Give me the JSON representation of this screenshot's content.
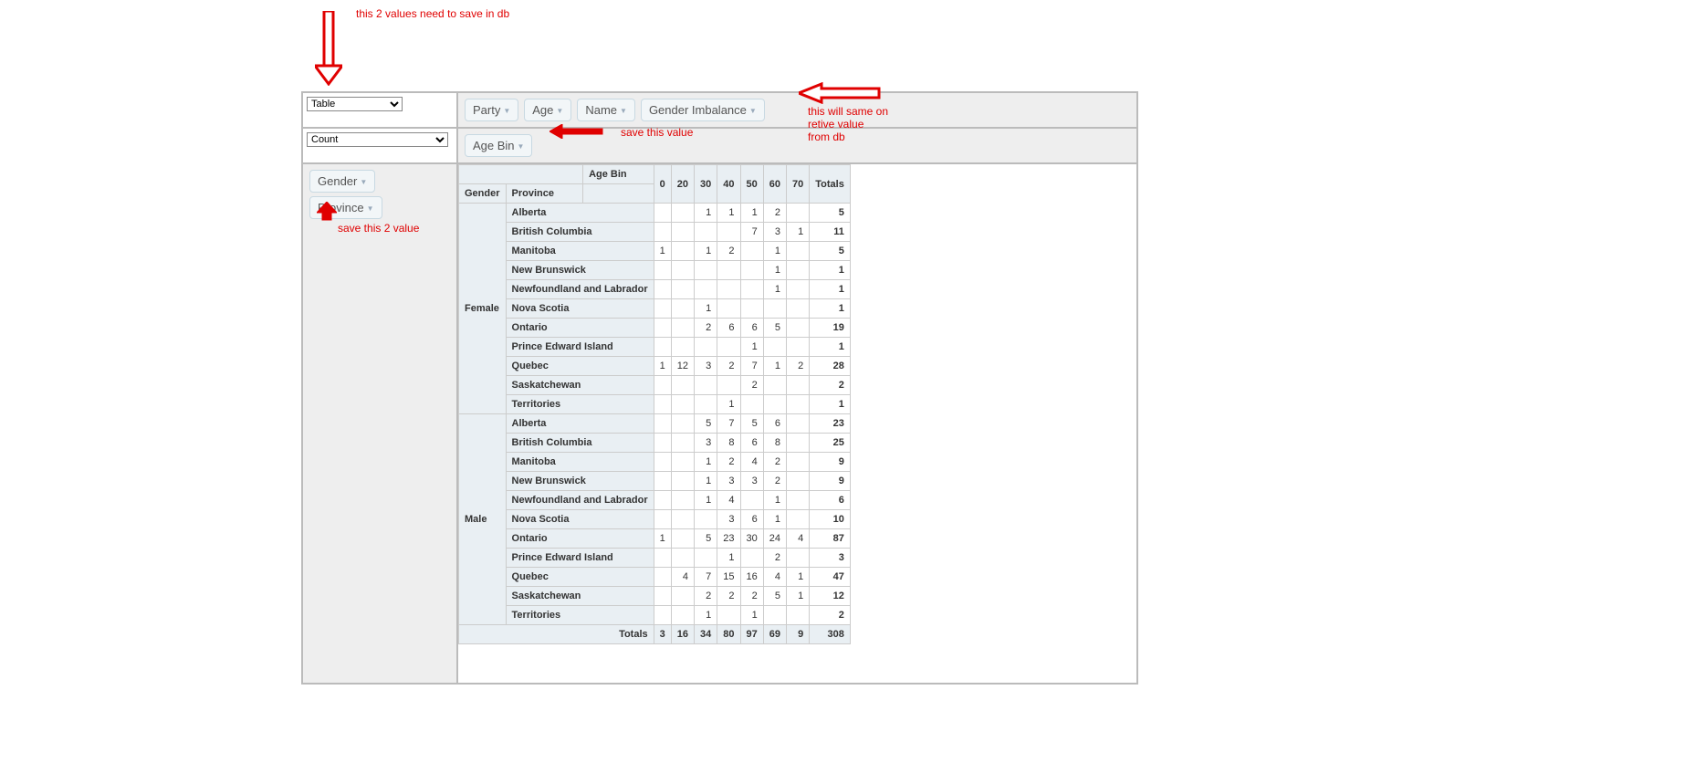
{
  "annotations": {
    "top": "this 2 values need to save in db",
    "rows": "save this 2 value",
    "cols": "save this value",
    "right1": "this will same on",
    "right2": "retive value",
    "right3": "from db"
  },
  "renderers": {
    "selected": "Table"
  },
  "aggregators": {
    "selected": "Count"
  },
  "unused_attrs": [
    "Party",
    "Age",
    "Name",
    "Gender Imbalance"
  ],
  "col_attrs": [
    "Age Bin"
  ],
  "row_attrs": [
    "Gender",
    "Province"
  ],
  "col_header": "Age Bin",
  "col_buckets": [
    "0",
    "20",
    "30",
    "40",
    "50",
    "60",
    "70"
  ],
  "totals_label": "Totals",
  "row_header_labels": [
    "Gender",
    "Province"
  ],
  "data_rows": [
    {
      "gender": "Female",
      "province": "Alberta",
      "cells": [
        "",
        "",
        "1",
        "1",
        "1",
        "2",
        ""
      ],
      "total": "5",
      "show_gender": false
    },
    {
      "gender": "Female",
      "province": "British Columbia",
      "cells": [
        "",
        "",
        "",
        "",
        "7",
        "3",
        "1"
      ],
      "total": "11",
      "show_gender": false
    },
    {
      "gender": "Female",
      "province": "Manitoba",
      "cells": [
        "1",
        "",
        "1",
        "2",
        "",
        "1",
        ""
      ],
      "total": "5",
      "show_gender": false
    },
    {
      "gender": "Female",
      "province": "New Brunswick",
      "cells": [
        "",
        "",
        "",
        "",
        "",
        "1",
        ""
      ],
      "total": "1",
      "show_gender": false
    },
    {
      "gender": "Female",
      "province": "Newfoundland and Labrador",
      "cells": [
        "",
        "",
        "",
        "",
        "",
        "1",
        ""
      ],
      "total": "1",
      "show_gender": false
    },
    {
      "gender": "Female",
      "province": "Nova Scotia",
      "cells": [
        "",
        "",
        "1",
        "",
        "",
        "",
        ""
      ],
      "total": "1",
      "show_gender": true
    },
    {
      "gender": "Female",
      "province": "Ontario",
      "cells": [
        "",
        "",
        "2",
        "6",
        "6",
        "5",
        ""
      ],
      "total": "19",
      "show_gender": false
    },
    {
      "gender": "Female",
      "province": "Prince Edward Island",
      "cells": [
        "",
        "",
        "",
        "",
        "1",
        "",
        ""
      ],
      "total": "1",
      "show_gender": false
    },
    {
      "gender": "Female",
      "province": "Quebec",
      "cells": [
        "1",
        "12",
        "3",
        "2",
        "7",
        "1",
        "2"
      ],
      "total": "28",
      "show_gender": false
    },
    {
      "gender": "Female",
      "province": "Saskatchewan",
      "cells": [
        "",
        "",
        "",
        "",
        "2",
        "",
        ""
      ],
      "total": "2",
      "show_gender": false
    },
    {
      "gender": "Female",
      "province": "Territories",
      "cells": [
        "",
        "",
        "",
        "1",
        "",
        "",
        ""
      ],
      "total": "1",
      "show_gender": false
    },
    {
      "gender": "Male",
      "province": "Alberta",
      "cells": [
        "",
        "",
        "5",
        "7",
        "5",
        "6",
        ""
      ],
      "total": "23",
      "show_gender": false
    },
    {
      "gender": "Male",
      "province": "British Columbia",
      "cells": [
        "",
        "",
        "3",
        "8",
        "6",
        "8",
        ""
      ],
      "total": "25",
      "show_gender": false
    },
    {
      "gender": "Male",
      "province": "Manitoba",
      "cells": [
        "",
        "",
        "1",
        "2",
        "4",
        "2",
        ""
      ],
      "total": "9",
      "show_gender": false
    },
    {
      "gender": "Male",
      "province": "New Brunswick",
      "cells": [
        "",
        "",
        "1",
        "3",
        "3",
        "2",
        ""
      ],
      "total": "9",
      "show_gender": false
    },
    {
      "gender": "Male",
      "province": "Newfoundland and Labrador",
      "cells": [
        "",
        "",
        "1",
        "4",
        "",
        "1",
        ""
      ],
      "total": "6",
      "show_gender": false
    },
    {
      "gender": "Male",
      "province": "Nova Scotia",
      "cells": [
        "",
        "",
        "",
        "3",
        "6",
        "1",
        ""
      ],
      "total": "10",
      "show_gender": true
    },
    {
      "gender": "Male",
      "province": "Ontario",
      "cells": [
        "1",
        "",
        "5",
        "23",
        "30",
        "24",
        "4"
      ],
      "total": "87",
      "show_gender": false
    },
    {
      "gender": "Male",
      "province": "Prince Edward Island",
      "cells": [
        "",
        "",
        "",
        "1",
        "",
        "2",
        ""
      ],
      "total": "3",
      "show_gender": false
    },
    {
      "gender": "Male",
      "province": "Quebec",
      "cells": [
        "",
        "4",
        "7",
        "15",
        "16",
        "4",
        "1"
      ],
      "total": "47",
      "show_gender": false
    },
    {
      "gender": "Male",
      "province": "Saskatchewan",
      "cells": [
        "",
        "",
        "2",
        "2",
        "2",
        "5",
        "1"
      ],
      "total": "12",
      "show_gender": false
    },
    {
      "gender": "Male",
      "province": "Territories",
      "cells": [
        "",
        "",
        "1",
        "",
        "1",
        "",
        ""
      ],
      "total": "2",
      "show_gender": false
    }
  ],
  "col_totals": [
    "3",
    "16",
    "34",
    "80",
    "97",
    "69",
    "9"
  ],
  "grand_total": "308"
}
